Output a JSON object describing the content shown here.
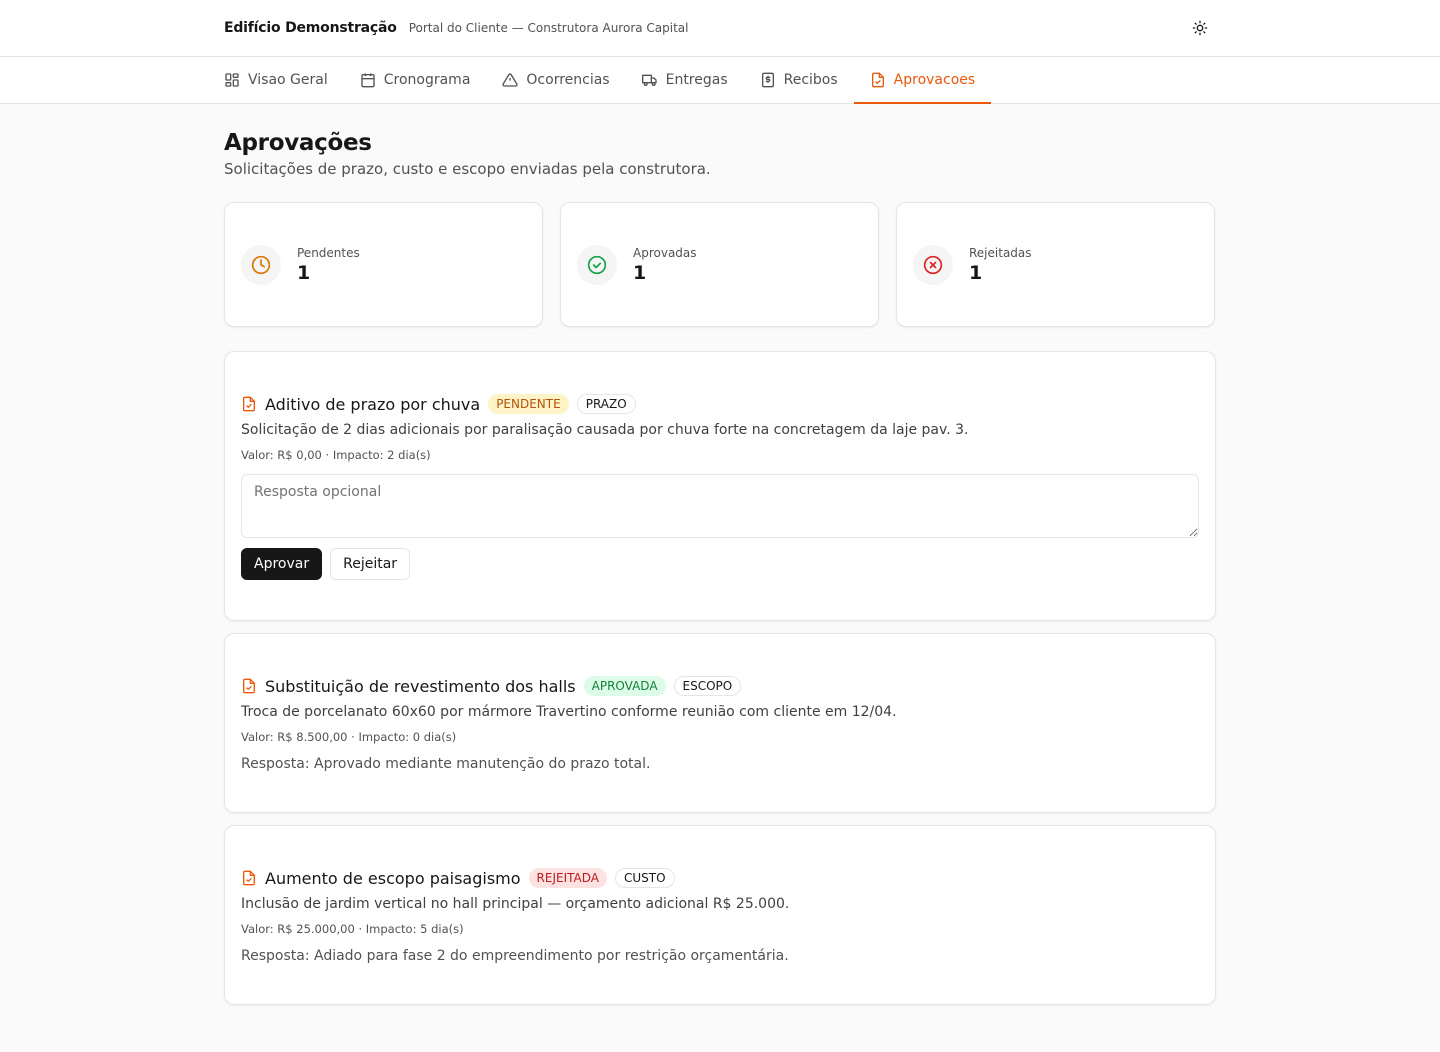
{
  "header": {
    "project": "Edifício Demonstração",
    "subtitle": "Portal do Cliente — Construtora Aurora Capital",
    "theme_icon": "sun-icon"
  },
  "tabs": [
    {
      "label": "Visao Geral",
      "icon": "grid-icon",
      "active": false
    },
    {
      "label": "Cronograma",
      "icon": "calendar-icon",
      "active": false
    },
    {
      "label": "Ocorrencias",
      "icon": "warning-icon",
      "active": false
    },
    {
      "label": "Entregas",
      "icon": "truck-icon",
      "active": false
    },
    {
      "label": "Recibos",
      "icon": "receipt-icon",
      "active": false
    },
    {
      "label": "Aprovacoes",
      "icon": "file-check-icon",
      "active": true
    }
  ],
  "page": {
    "title": "Aprovações",
    "subtitle": "Solicitações de prazo, custo e escopo enviadas pela construtora."
  },
  "stats": [
    {
      "label": "Pendentes",
      "value": "1",
      "icon": "clock-icon",
      "color": "#d97706"
    },
    {
      "label": "Aprovadas",
      "value": "1",
      "icon": "check-circle-icon",
      "color": "#16a34a"
    },
    {
      "label": "Rejeitadas",
      "value": "1",
      "icon": "x-circle-icon",
      "color": "#dc2626"
    }
  ],
  "requests": [
    {
      "title": "Aditivo de prazo por chuva",
      "status": "PENDENTE",
      "type": "PRAZO",
      "description": "Solicitação de 2 dias adicionais por paralisação causada por chuva forte na concretagem da laje pav. 3.",
      "meta": "Valor: R$ 0,00 · Impacto: 2 dia(s)",
      "response_placeholder": "Resposta opcional",
      "approve_label": "Aprovar",
      "reject_label": "Rejeitar"
    },
    {
      "title": "Substituição de revestimento dos halls",
      "status": "APROVADA",
      "type": "ESCOPO",
      "description": "Troca de porcelanato 60x60 por mármore Travertino conforme reunião com cliente em 12/04.",
      "meta": "Valor: R$ 8.500,00 · Impacto: 0 dia(s)",
      "response": "Resposta: Aprovado mediante manutenção do prazo total."
    },
    {
      "title": "Aumento de escopo paisagismo",
      "status": "REJEITADA",
      "type": "CUSTO",
      "description": "Inclusão de jardim vertical no hall principal — orçamento adicional R$ 25.000.",
      "meta": "Valor: R$ 25.000,00 · Impacto: 5 dia(s)",
      "response": "Resposta: Adiado para fase 2 do empreendimento por restrição orçamentária."
    }
  ],
  "colors": {
    "accent": "#ea580c",
    "pending": "#d97706",
    "approved": "#16a34a",
    "rejected": "#dc2626"
  }
}
